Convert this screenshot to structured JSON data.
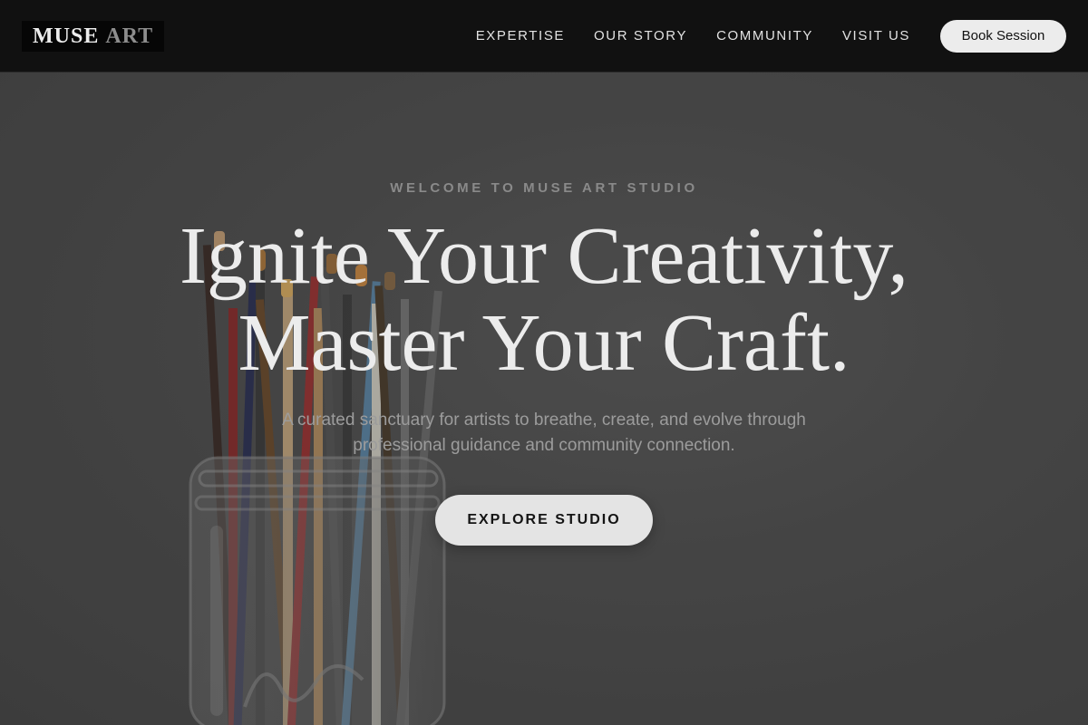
{
  "header": {
    "logo": {
      "word1": "MUSE",
      "word2": "ART"
    },
    "nav": [
      {
        "label": "EXPERTISE"
      },
      {
        "label": "OUR STORY"
      },
      {
        "label": "COMMUNITY"
      },
      {
        "label": "VISIT US"
      }
    ],
    "cta_label": "Book Session"
  },
  "hero": {
    "eyebrow": "WELCOME TO MUSE ART STUDIO",
    "headline_line1": "Ignite Your Creativity,",
    "headline_line2": "Master Your Craft.",
    "sub_line1": "A curated sanctuary for artists to breathe, create, and evolve through",
    "sub_line2": "professional guidance and community connection.",
    "cta_label": "EXPLORE STUDIO",
    "background_image": "jar-of-paintbrushes-photo"
  },
  "colors": {
    "header_bg": "#111111",
    "hero_bg": "#4a4a4a",
    "button_bg": "#ececec",
    "text_light": "#ececec",
    "text_muted": "#9c9c9c"
  }
}
